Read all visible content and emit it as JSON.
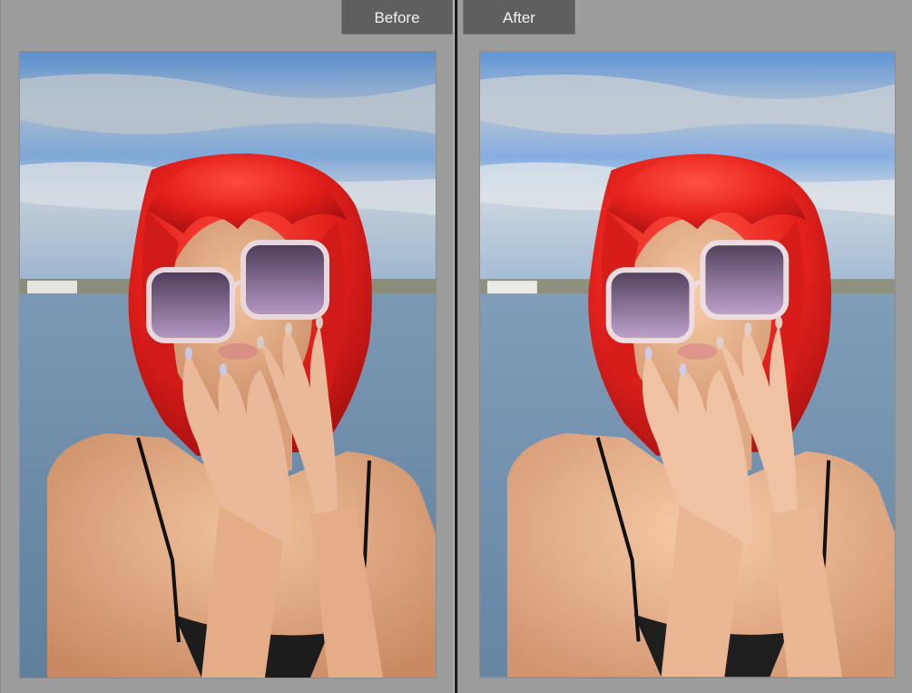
{
  "view": {
    "before_label": "Before",
    "after_label": "After"
  },
  "colors": {
    "panel_bg": "#9c9c9c",
    "tab_bg": "#5f5f5f",
    "tab_text": "#f2f2f2",
    "divider": "#1a1a1a",
    "sky": "#5a8fd0",
    "water": "#6e8fae",
    "hair": "#e0231f",
    "skin": "#e8b48f"
  }
}
